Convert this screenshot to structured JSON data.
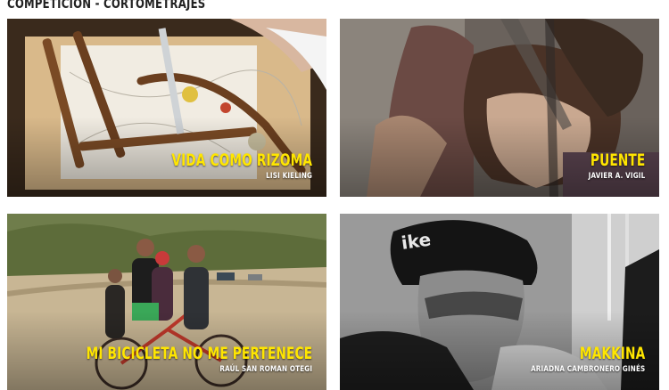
{
  "section": {
    "title": "COMPETICIÓN - CORTOMETRAJES"
  },
  "films": [
    {
      "title": "VIDA COMO RIZOMA",
      "director": "LISI KIELING",
      "image": "workshop-table-photo"
    },
    {
      "title": "PUENTE",
      "director": "JAVIER A. VIGIL",
      "image": "embracing-couple-photo"
    },
    {
      "title": "MI BICICLETA NO ME PERTENECE",
      "director": "RAÚL SAN ROMAN OTEGI",
      "image": "family-on-bicycle-photo"
    },
    {
      "title": "MAKKINA",
      "director": "ARIADNA CAMBRONERO GINÉS",
      "image": "cyclist-helmet-photo"
    }
  ],
  "colors": {
    "title_accent": "#ffe600",
    "director_text": "#ffffff",
    "heading": "#222222"
  }
}
